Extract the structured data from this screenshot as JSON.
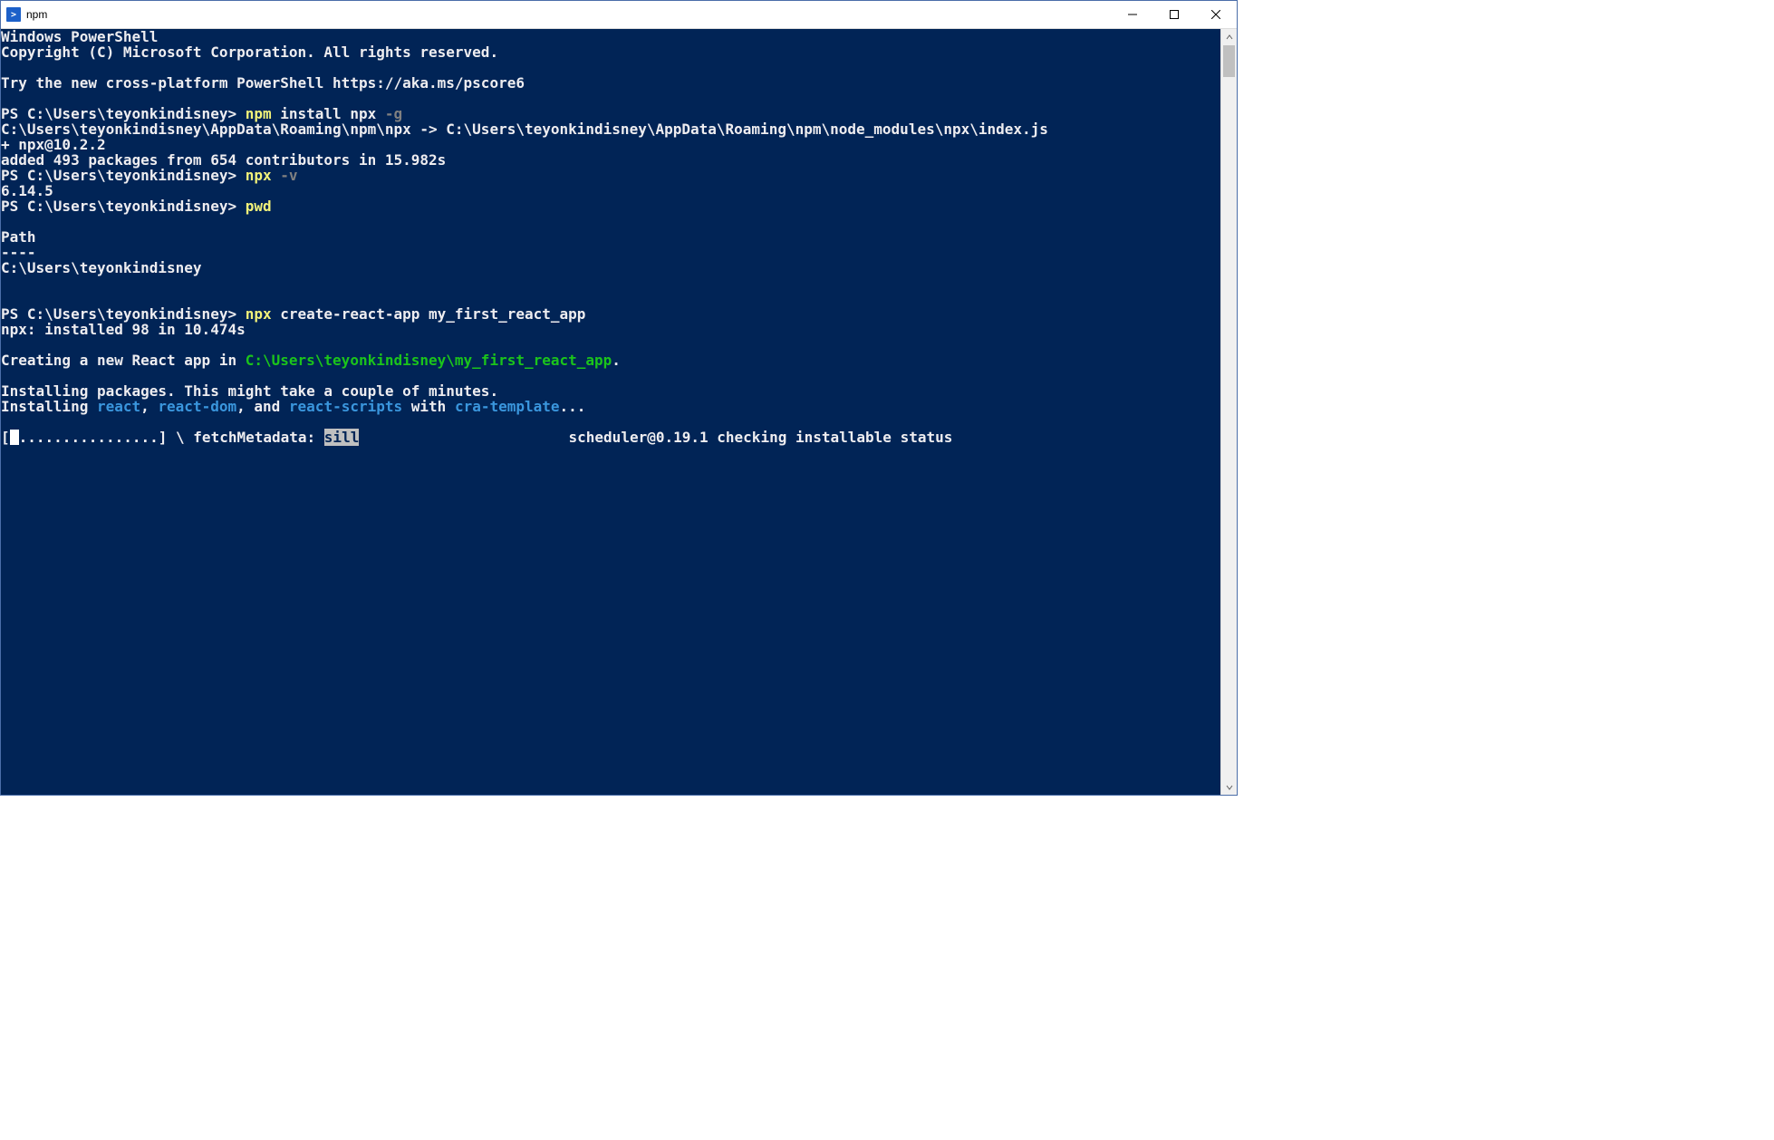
{
  "title_bar": {
    "title_text": "npm",
    "icon_label": ">"
  },
  "terminal": {
    "welcome": {
      "line1": "Windows PowerShell",
      "line2": "Copyright (C) Microsoft Corporation. All rights reserved.",
      "line3": "Try the new cross-platform PowerShell https://aka.ms/pscore6"
    },
    "prompt": "PS C:\\Users\\teyonkindisney> ",
    "cmd1": {
      "exe": "npm",
      "args_plain": " install npx ",
      "args_gray": "-g"
    },
    "out1a": "C:\\Users\\teyonkindisney\\AppData\\Roaming\\npm\\npx -> C:\\Users\\teyonkindisney\\AppData\\Roaming\\npm\\node_modules\\npx\\index.js",
    "out1b": "+ npx@10.2.2",
    "out1c": "added 493 packages from 654 contributors in 15.982s",
    "cmd2": {
      "exe": "npx",
      "args_gray": " -v"
    },
    "out2": "6.14.5",
    "cmd3": {
      "exe": "pwd"
    },
    "out3a": "Path",
    "out3b": "----",
    "out3c": "C:\\Users\\teyonkindisney",
    "cmd4": {
      "exe": "npx",
      "args_plain": " create-react-app my_first_react_app"
    },
    "out4": "npx: installed 98 in 10.474s",
    "creating": {
      "pre": "Creating a new React app in ",
      "path": "C:\\Users\\teyonkindisney\\my_first_react_app",
      "post": "."
    },
    "installing_msg": "Installing packages. This might take a couple of minutes.",
    "installing_list": {
      "pre": "Installing ",
      "p1": "react",
      "s1": ", ",
      "p2": "react-dom",
      "s2": ", and ",
      "p3": "react-scripts",
      "s3": " with ",
      "p4": "cra-template",
      "post": "..."
    },
    "progress": {
      "open": "[",
      "bar_tail": "................] \\ fetchMetadata: ",
      "sill": "sill",
      "gap": "                        ",
      "suffix": "scheduler@0.19.1 checking installable status"
    }
  }
}
